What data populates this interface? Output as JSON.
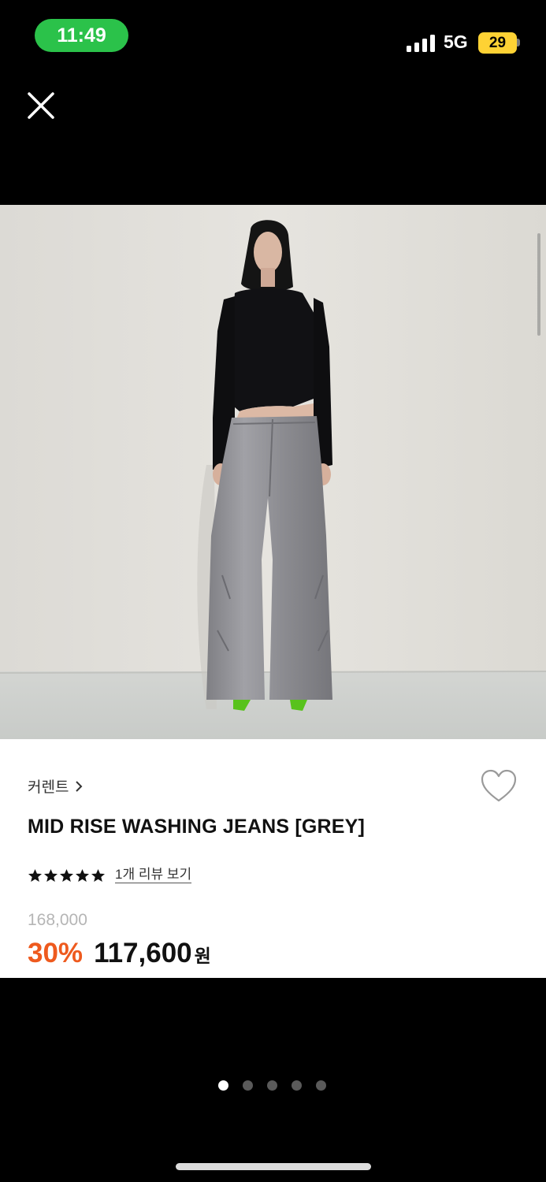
{
  "status_bar": {
    "time": "11:49",
    "network": "5G",
    "battery": "29",
    "time_pill_color": "#2bc24a",
    "battery_color": "#fed234"
  },
  "header": {
    "close_icon": "close-icon"
  },
  "gallery": {
    "image_icon": "product-photo-model-in-grey-wide-jeans",
    "pages": 5,
    "active_page": 1
  },
  "product": {
    "brand": "커렌트",
    "brand_chevron": ">",
    "title": "MID RISE WASHING JEANS [GREY]",
    "stars": 5,
    "review_link": "1개 리뷰 보기",
    "original_price": "168,000",
    "discount": "30%",
    "sale_price": "117,600",
    "currency": "원",
    "discount_color": "#ee5a1e"
  }
}
